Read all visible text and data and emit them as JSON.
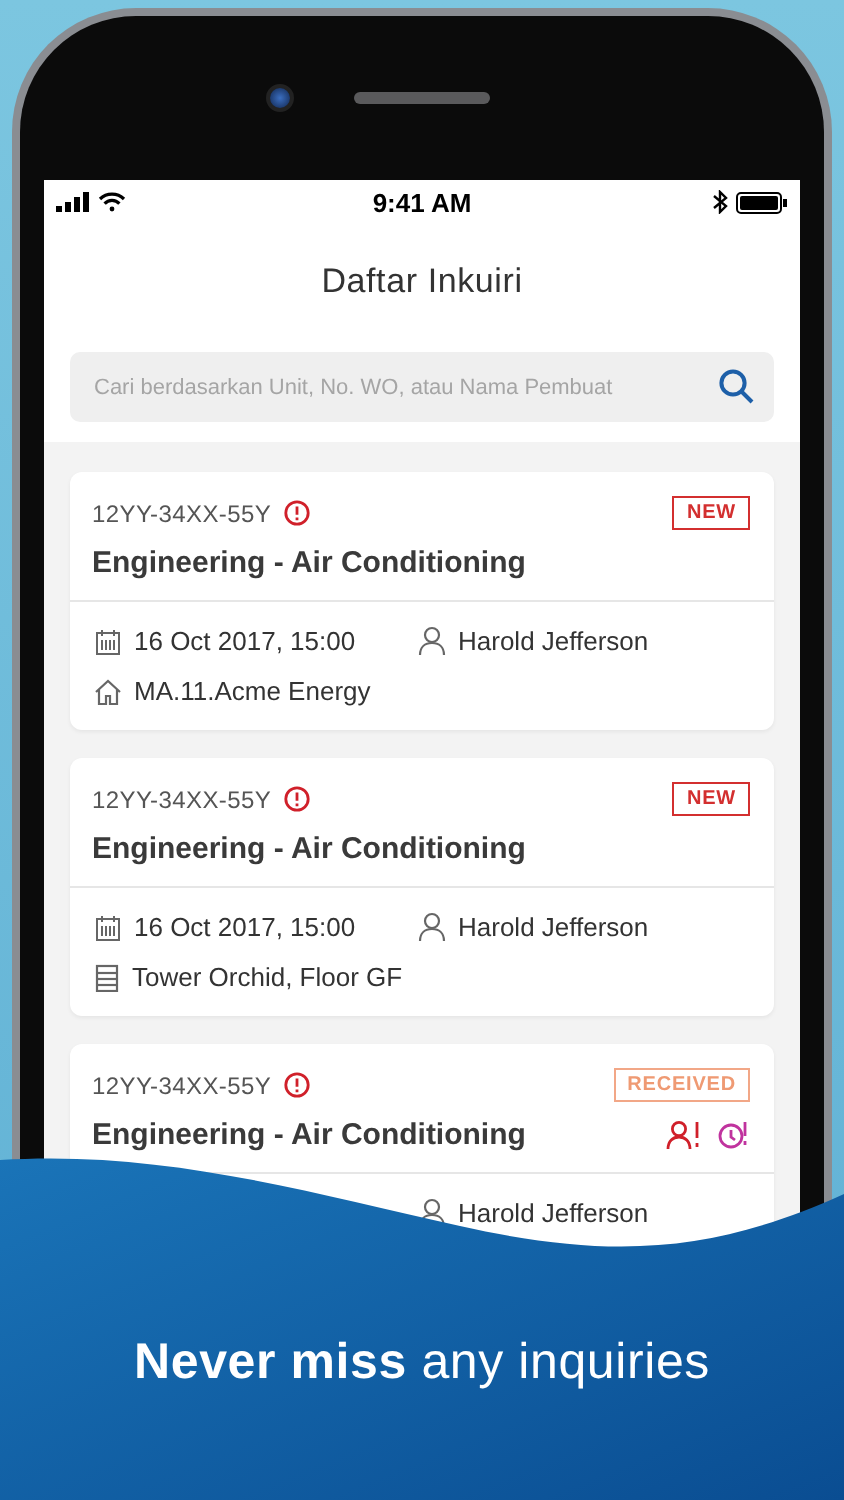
{
  "status_bar": {
    "time": "9:41 AM"
  },
  "header": {
    "title": "Daftar Inkuiri"
  },
  "search": {
    "placeholder": "Cari berdasarkan Unit, No. WO, atau Nama Pembuat"
  },
  "inquiries": [
    {
      "code": "12YY-34XX-55Y",
      "urgent": true,
      "title": "Engineering - Air Conditioning",
      "status": "NEW",
      "kind": "new",
      "details": [
        {
          "kind": "date",
          "text": "16 Oct 2017, 15:00"
        },
        {
          "kind": "person",
          "text": "Harold Jefferson"
        },
        {
          "kind": "address",
          "text": "MA.11.Acme Energy"
        }
      ]
    },
    {
      "code": "12YY-34XX-55Y",
      "urgent": true,
      "title": "Engineering - Air Conditioning",
      "status": "NEW",
      "kind": "new",
      "details": [
        {
          "kind": "date",
          "text": "16 Oct 2017, 15:00"
        },
        {
          "kind": "person",
          "text": "Harold Jefferson"
        },
        {
          "kind": "building",
          "text": "Tower Orchid, Floor GF"
        }
      ]
    },
    {
      "code": "12YY-34XX-55Y",
      "urgent": true,
      "title": "Engineering - Air Conditioning",
      "status": "RECEIVED",
      "kind": "received",
      "alerts": [
        {
          "kind": "person"
        },
        {
          "kind": "clock"
        }
      ],
      "details": [
        {
          "kind": "person",
          "text": "Harold Jefferson"
        }
      ]
    }
  ],
  "caption": "**Never miss** any inquiries"
}
